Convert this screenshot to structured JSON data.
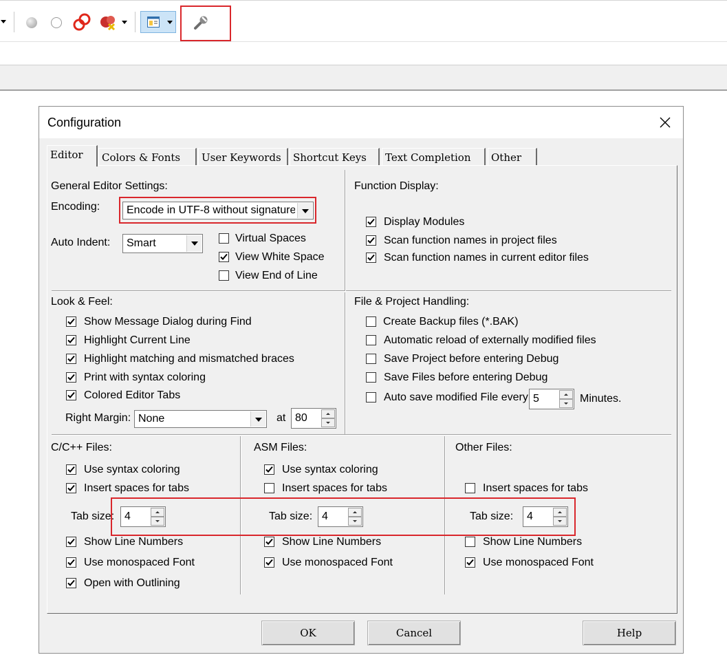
{
  "dialog": {
    "title": "Configuration",
    "tabs": [
      "Editor",
      "Colors & Fonts",
      "User Keywords",
      "Shortcut Keys",
      "Text Completion",
      "Other"
    ],
    "buttons": {
      "ok": "OK",
      "cancel": "Cancel",
      "help": "Help"
    }
  },
  "general": {
    "heading": "General Editor Settings:",
    "encoding_label": "Encoding:",
    "encoding_value": "Encode in UTF-8 without signature",
    "auto_indent_label": "Auto Indent:",
    "auto_indent_value": "Smart",
    "virtual_spaces": {
      "label": "Virtual Spaces",
      "checked": false
    },
    "view_white_space": {
      "label": "View White Space",
      "checked": true
    },
    "view_end_of_line": {
      "label": "View End of Line",
      "checked": false
    }
  },
  "function_display": {
    "heading": "Function Display:",
    "items": [
      {
        "label": "Display Modules",
        "checked": true
      },
      {
        "label": "Scan function names in project files",
        "checked": true
      },
      {
        "label": "Scan function names in current editor files",
        "checked": true
      }
    ]
  },
  "look_feel": {
    "heading": "Look & Feel:",
    "items": [
      {
        "label": "Show Message Dialog during Find",
        "checked": true
      },
      {
        "label": "Highlight Current Line",
        "checked": true
      },
      {
        "label": "Highlight matching and mismatched braces",
        "checked": true
      },
      {
        "label": "Print with syntax coloring",
        "checked": true
      },
      {
        "label": "Colored Editor Tabs",
        "checked": true
      }
    ],
    "right_margin_label": "Right Margin:",
    "right_margin_value": "None",
    "at_label": "at",
    "at_value": "80"
  },
  "file_project": {
    "heading": "File & Project Handling:",
    "items": [
      {
        "label": "Create Backup files (*.BAK)",
        "checked": false
      },
      {
        "label": "Automatic reload of externally modified files",
        "checked": false
      },
      {
        "label": "Save Project before entering Debug",
        "checked": false
      },
      {
        "label": "Save Files before entering Debug",
        "checked": false
      }
    ],
    "autosave": {
      "label": "Auto save modified File every",
      "checked": false,
      "value": "5",
      "unit": "Minutes."
    }
  },
  "cpp_files": {
    "heading": "C/C++ Files:",
    "use_syntax_coloring": {
      "label": "Use syntax coloring",
      "checked": true
    },
    "insert_spaces": {
      "label": "Insert spaces for tabs",
      "checked": true
    },
    "tab_size_label": "Tab size:",
    "tab_size_value": "4",
    "show_line_numbers": {
      "label": "Show Line Numbers",
      "checked": true
    },
    "monospaced": {
      "label": "Use monospaced Font",
      "checked": true
    },
    "outlining": {
      "label": "Open with Outlining",
      "checked": true
    }
  },
  "asm_files": {
    "heading": "ASM Files:",
    "use_syntax_coloring": {
      "label": "Use syntax coloring",
      "checked": true
    },
    "insert_spaces": {
      "label": "Insert spaces for tabs",
      "checked": false
    },
    "tab_size_label": "Tab size:",
    "tab_size_value": "4",
    "show_line_numbers": {
      "label": "Show Line Numbers",
      "checked": true
    },
    "monospaced": {
      "label": "Use monospaced Font",
      "checked": true
    }
  },
  "other_files": {
    "heading": "Other Files:",
    "insert_spaces": {
      "label": "Insert spaces for tabs",
      "checked": false
    },
    "tab_size_label": "Tab size:",
    "tab_size_value": "4",
    "show_line_numbers": {
      "label": "Show Line Numbers",
      "checked": false
    },
    "monospaced": {
      "label": "Use monospaced Font",
      "checked": true
    }
  },
  "colors": {
    "highlight_box": "#d9262b",
    "dialog_face": "#f0f0f0"
  },
  "icons": [
    "breakpoint-icon",
    "breakpoint-disabled-icon",
    "breakpoints-icon",
    "kill-breakpoints-icon",
    "window-layout-icon",
    "wrench-icon"
  ]
}
